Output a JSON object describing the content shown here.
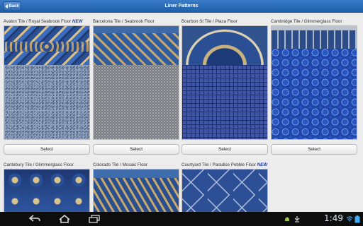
{
  "header": {
    "back_label": "Back",
    "title": "Liner Patterns"
  },
  "patterns": [
    {
      "label": "Avalon Tile / Royal Seabrook Floor",
      "badge": "NEW",
      "button": "Select"
    },
    {
      "label": "Barcelona Tile / Seabrook Floor",
      "badge": "",
      "button": "Select"
    },
    {
      "label": "Bourbon St Tile / Plaza Floor",
      "badge": "",
      "button": "Select"
    },
    {
      "label": "Cambridge Tile / Glimmerglass Floor",
      "badge": "",
      "button": "Select"
    },
    {
      "label": "Cantebury Tile / Glimmerglass Floor",
      "badge": "",
      "button": ""
    },
    {
      "label": "Colorado Tile / Mosaic Floor",
      "badge": "",
      "button": ""
    },
    {
      "label": "Courtyard Tile / Paradise Pebble Floor",
      "badge": "NEW",
      "button": ""
    }
  ],
  "statusbar": {
    "time": "1:49",
    "icons": [
      "back-icon",
      "home-icon",
      "recent-apps-icon",
      "android-notification-icon",
      "download-icon",
      "wifi-icon",
      "battery-icon"
    ]
  },
  "colors": {
    "header": "#2a6bb8",
    "badge": "#1b3fa8",
    "navbar": "#0d0d0d"
  }
}
